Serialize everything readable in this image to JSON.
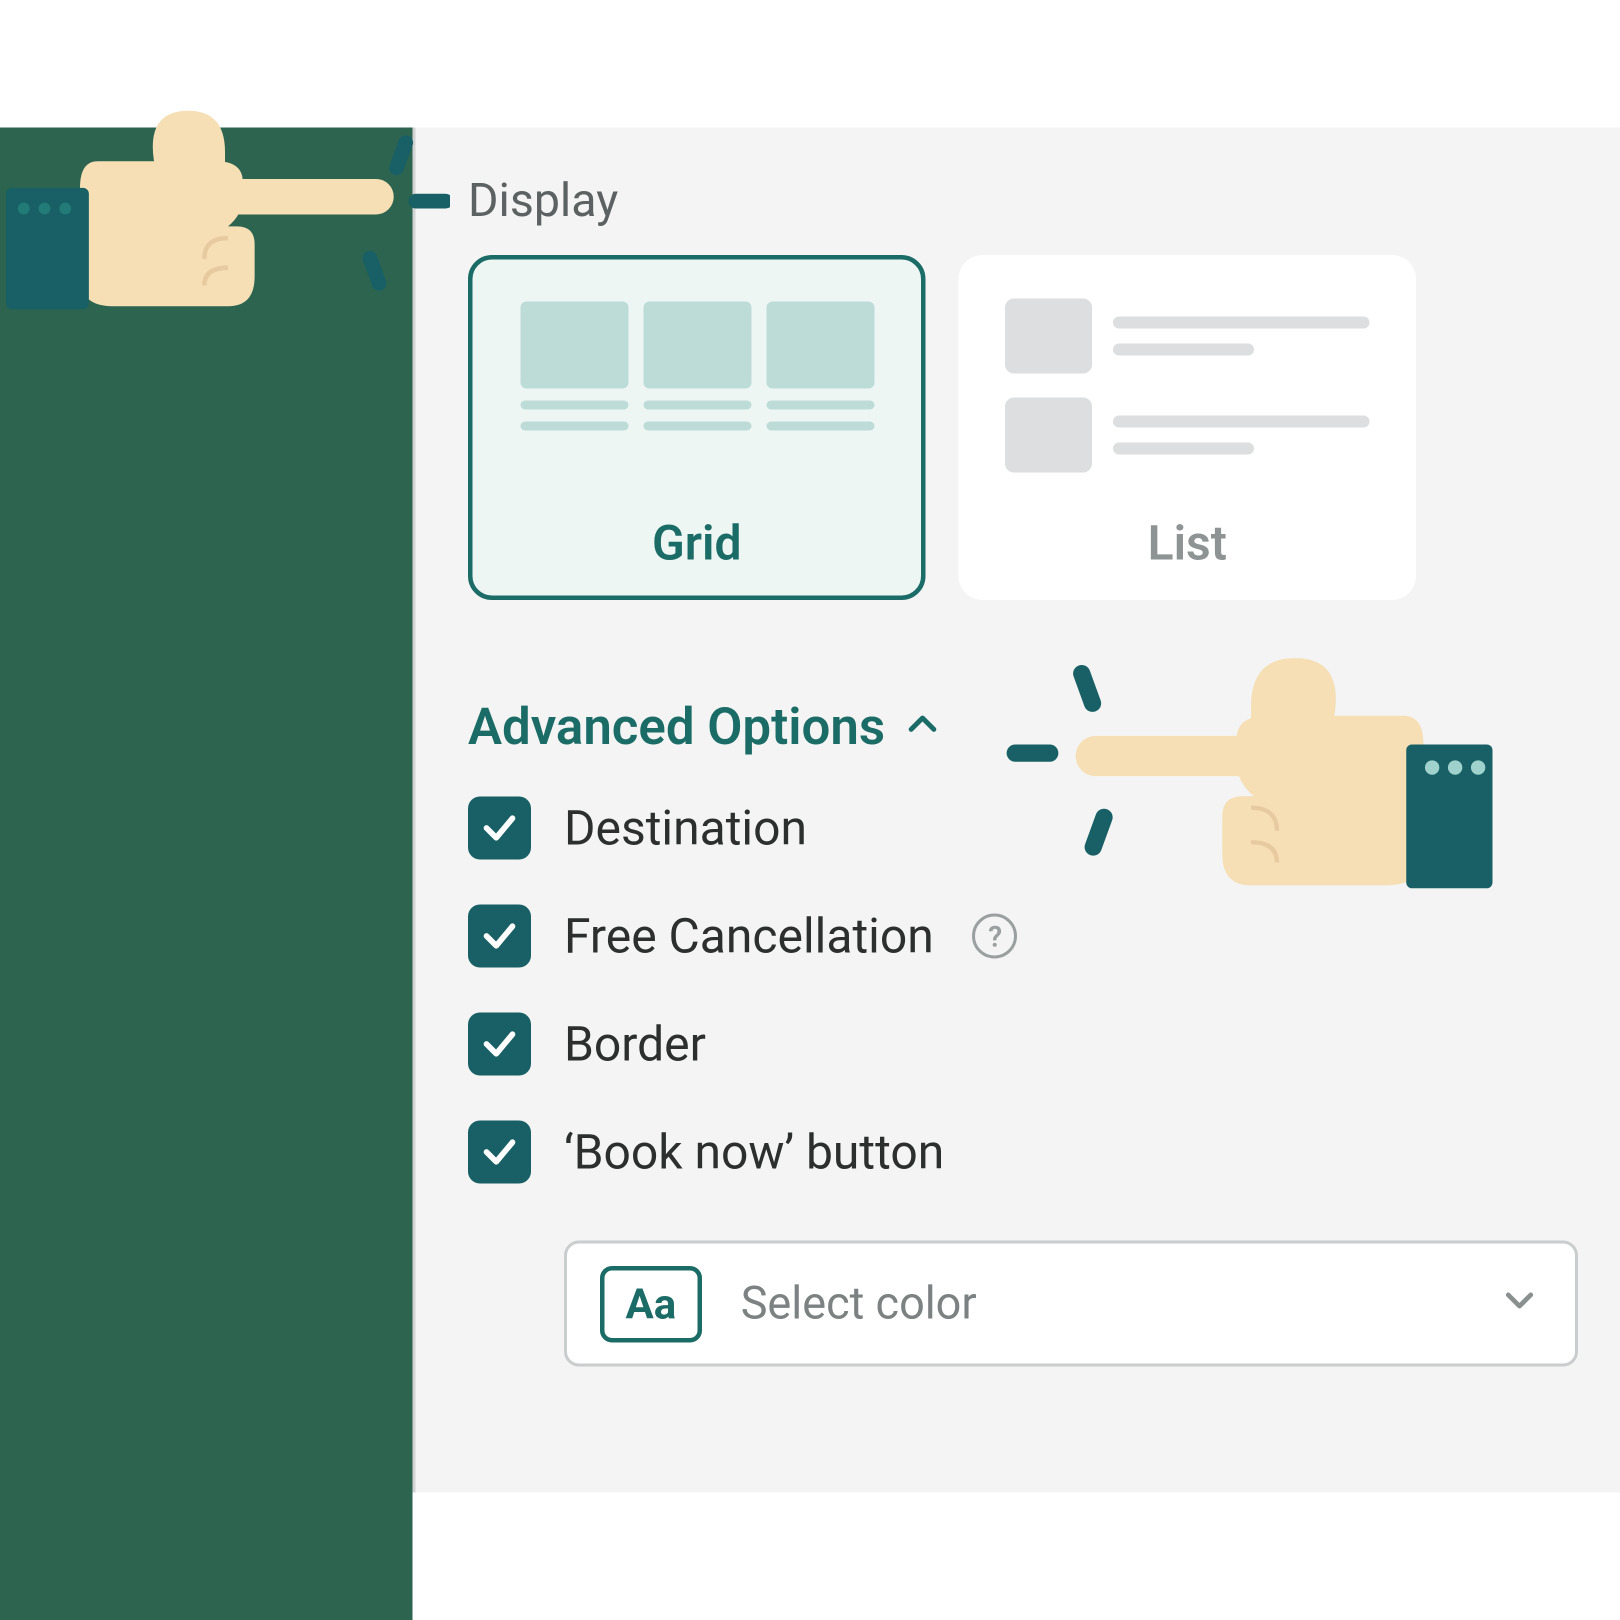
{
  "display": {
    "section_label": "Display",
    "options": {
      "grid": {
        "label": "Grid",
        "selected": true
      },
      "list": {
        "label": "List",
        "selected": false
      }
    }
  },
  "advanced": {
    "header": "Advanced Options",
    "expanded": true,
    "items": [
      {
        "label": "Destination",
        "checked": true,
        "help": false
      },
      {
        "label": "Free Cancellation",
        "checked": true,
        "help": true
      },
      {
        "label": "Border",
        "checked": true,
        "help": false
      },
      {
        "label": "‘Book now’ button",
        "checked": true,
        "help": false
      }
    ],
    "color_select": {
      "aa_badge": "Aa",
      "placeholder": "Select color"
    }
  },
  "colors": {
    "accent": "#1b6b66",
    "check_bg": "#186065",
    "panel_bg": "#f3f4f3",
    "green_bg": "#2C6450"
  }
}
